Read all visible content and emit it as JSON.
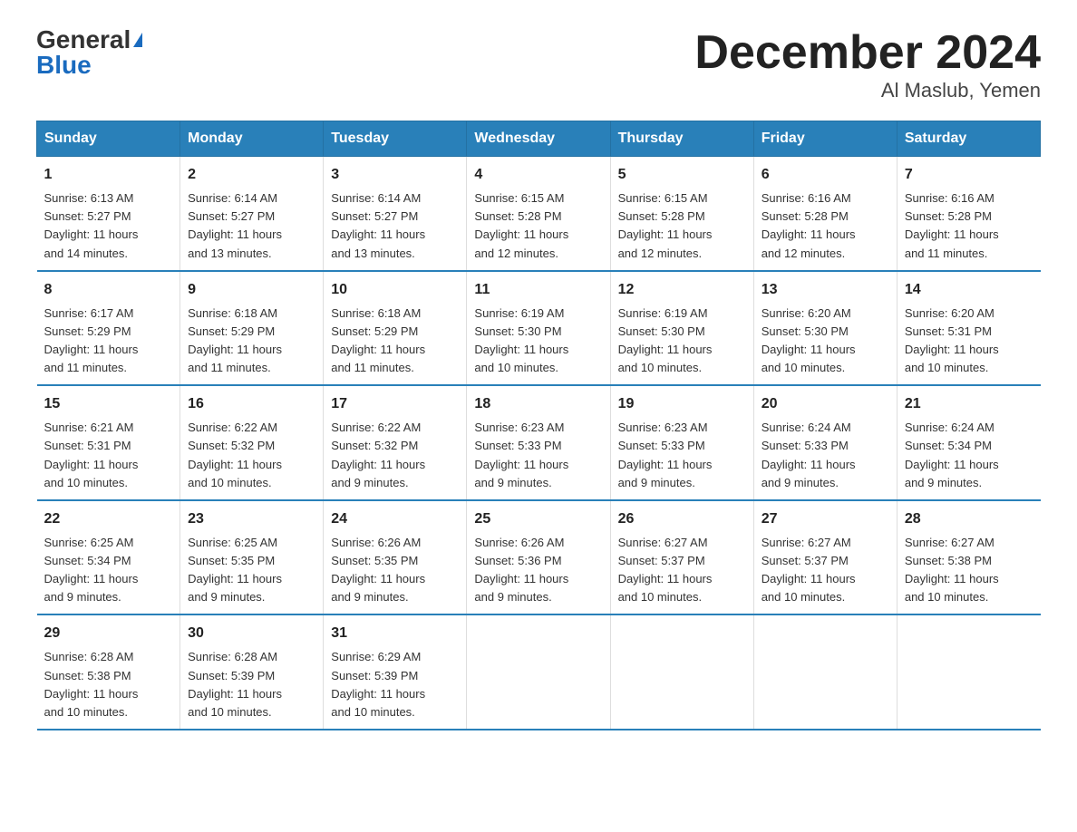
{
  "header": {
    "logo_general": "General",
    "logo_blue": "Blue",
    "title": "December 2024",
    "subtitle": "Al Maslub, Yemen"
  },
  "calendar": {
    "weekdays": [
      "Sunday",
      "Monday",
      "Tuesday",
      "Wednesday",
      "Thursday",
      "Friday",
      "Saturday"
    ],
    "weeks": [
      [
        {
          "day": "1",
          "info": "Sunrise: 6:13 AM\nSunset: 5:27 PM\nDaylight: 11 hours\nand 14 minutes."
        },
        {
          "day": "2",
          "info": "Sunrise: 6:14 AM\nSunset: 5:27 PM\nDaylight: 11 hours\nand 13 minutes."
        },
        {
          "day": "3",
          "info": "Sunrise: 6:14 AM\nSunset: 5:27 PM\nDaylight: 11 hours\nand 13 minutes."
        },
        {
          "day": "4",
          "info": "Sunrise: 6:15 AM\nSunset: 5:28 PM\nDaylight: 11 hours\nand 12 minutes."
        },
        {
          "day": "5",
          "info": "Sunrise: 6:15 AM\nSunset: 5:28 PM\nDaylight: 11 hours\nand 12 minutes."
        },
        {
          "day": "6",
          "info": "Sunrise: 6:16 AM\nSunset: 5:28 PM\nDaylight: 11 hours\nand 12 minutes."
        },
        {
          "day": "7",
          "info": "Sunrise: 6:16 AM\nSunset: 5:28 PM\nDaylight: 11 hours\nand 11 minutes."
        }
      ],
      [
        {
          "day": "8",
          "info": "Sunrise: 6:17 AM\nSunset: 5:29 PM\nDaylight: 11 hours\nand 11 minutes."
        },
        {
          "day": "9",
          "info": "Sunrise: 6:18 AM\nSunset: 5:29 PM\nDaylight: 11 hours\nand 11 minutes."
        },
        {
          "day": "10",
          "info": "Sunrise: 6:18 AM\nSunset: 5:29 PM\nDaylight: 11 hours\nand 11 minutes."
        },
        {
          "day": "11",
          "info": "Sunrise: 6:19 AM\nSunset: 5:30 PM\nDaylight: 11 hours\nand 10 minutes."
        },
        {
          "day": "12",
          "info": "Sunrise: 6:19 AM\nSunset: 5:30 PM\nDaylight: 11 hours\nand 10 minutes."
        },
        {
          "day": "13",
          "info": "Sunrise: 6:20 AM\nSunset: 5:30 PM\nDaylight: 11 hours\nand 10 minutes."
        },
        {
          "day": "14",
          "info": "Sunrise: 6:20 AM\nSunset: 5:31 PM\nDaylight: 11 hours\nand 10 minutes."
        }
      ],
      [
        {
          "day": "15",
          "info": "Sunrise: 6:21 AM\nSunset: 5:31 PM\nDaylight: 11 hours\nand 10 minutes."
        },
        {
          "day": "16",
          "info": "Sunrise: 6:22 AM\nSunset: 5:32 PM\nDaylight: 11 hours\nand 10 minutes."
        },
        {
          "day": "17",
          "info": "Sunrise: 6:22 AM\nSunset: 5:32 PM\nDaylight: 11 hours\nand 9 minutes."
        },
        {
          "day": "18",
          "info": "Sunrise: 6:23 AM\nSunset: 5:33 PM\nDaylight: 11 hours\nand 9 minutes."
        },
        {
          "day": "19",
          "info": "Sunrise: 6:23 AM\nSunset: 5:33 PM\nDaylight: 11 hours\nand 9 minutes."
        },
        {
          "day": "20",
          "info": "Sunrise: 6:24 AM\nSunset: 5:33 PM\nDaylight: 11 hours\nand 9 minutes."
        },
        {
          "day": "21",
          "info": "Sunrise: 6:24 AM\nSunset: 5:34 PM\nDaylight: 11 hours\nand 9 minutes."
        }
      ],
      [
        {
          "day": "22",
          "info": "Sunrise: 6:25 AM\nSunset: 5:34 PM\nDaylight: 11 hours\nand 9 minutes."
        },
        {
          "day": "23",
          "info": "Sunrise: 6:25 AM\nSunset: 5:35 PM\nDaylight: 11 hours\nand 9 minutes."
        },
        {
          "day": "24",
          "info": "Sunrise: 6:26 AM\nSunset: 5:35 PM\nDaylight: 11 hours\nand 9 minutes."
        },
        {
          "day": "25",
          "info": "Sunrise: 6:26 AM\nSunset: 5:36 PM\nDaylight: 11 hours\nand 9 minutes."
        },
        {
          "day": "26",
          "info": "Sunrise: 6:27 AM\nSunset: 5:37 PM\nDaylight: 11 hours\nand 10 minutes."
        },
        {
          "day": "27",
          "info": "Sunrise: 6:27 AM\nSunset: 5:37 PM\nDaylight: 11 hours\nand 10 minutes."
        },
        {
          "day": "28",
          "info": "Sunrise: 6:27 AM\nSunset: 5:38 PM\nDaylight: 11 hours\nand 10 minutes."
        }
      ],
      [
        {
          "day": "29",
          "info": "Sunrise: 6:28 AM\nSunset: 5:38 PM\nDaylight: 11 hours\nand 10 minutes."
        },
        {
          "day": "30",
          "info": "Sunrise: 6:28 AM\nSunset: 5:39 PM\nDaylight: 11 hours\nand 10 minutes."
        },
        {
          "day": "31",
          "info": "Sunrise: 6:29 AM\nSunset: 5:39 PM\nDaylight: 11 hours\nand 10 minutes."
        },
        {
          "day": "",
          "info": ""
        },
        {
          "day": "",
          "info": ""
        },
        {
          "day": "",
          "info": ""
        },
        {
          "day": "",
          "info": ""
        }
      ]
    ]
  }
}
